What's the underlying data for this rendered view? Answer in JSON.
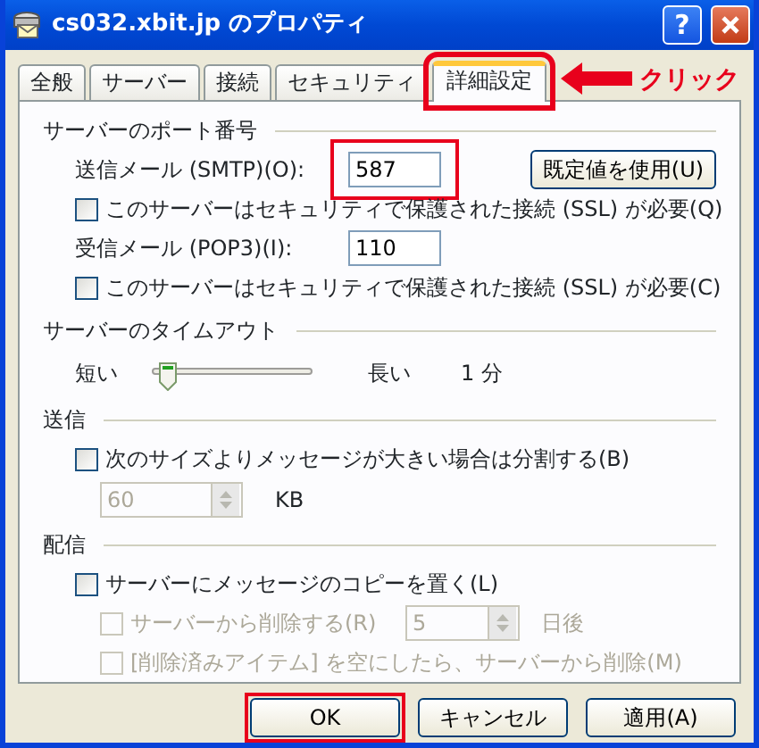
{
  "window": {
    "title": "cs032.xbit.jp のプロパティ",
    "help_label": "?"
  },
  "tabs": [
    {
      "label": "全般",
      "selected": false,
      "highlighted": false
    },
    {
      "label": "サーバー",
      "selected": false,
      "highlighted": false
    },
    {
      "label": "接続",
      "selected": false,
      "highlighted": false
    },
    {
      "label": "セキュリティ",
      "selected": false,
      "highlighted": false
    },
    {
      "label": "詳細設定",
      "selected": true,
      "highlighted": true
    }
  ],
  "annotation": {
    "text": "クリック"
  },
  "sections": [
    {
      "title": "サーバーのポート番号",
      "rows": [
        {
          "kind": "port",
          "label": "送信メール (SMTP)(O):",
          "value": "587",
          "highlighted": true,
          "button": "既定値を使用(U)"
        },
        {
          "kind": "checkbox",
          "label": "このサーバーはセキュリティで保護された接続 (SSL) が必要(Q)",
          "checked": false,
          "disabled": false
        },
        {
          "kind": "port",
          "label": "受信メール (POP3)(I):",
          "value": "110",
          "highlighted": false
        },
        {
          "kind": "checkbox",
          "label": "このサーバーはセキュリティで保護された接続 (SSL) が必要(C)",
          "checked": false,
          "disabled": false
        }
      ]
    },
    {
      "title": "サーバーのタイムアウト",
      "rows": [
        {
          "kind": "slider",
          "min_label": "短い",
          "max_label": "長い",
          "level": 0.1,
          "reading": "1 分"
        }
      ]
    },
    {
      "title": "送信",
      "rows": [
        {
          "kind": "checkbox",
          "label": "次のサイズよりメッセージが大きい場合は分割する(B)",
          "checked": false,
          "disabled": false
        },
        {
          "kind": "spinner",
          "value": "60",
          "unit": "KB",
          "disabled": true
        }
      ]
    },
    {
      "title": "配信",
      "rows": [
        {
          "kind": "checkbox",
          "label": "サーバーにメッセージのコピーを置く(L)",
          "checked": false,
          "disabled": false
        },
        {
          "kind": "checkbox_spinner",
          "label": "サーバーから削除する(R)",
          "checked": false,
          "disabled": true,
          "value": "5",
          "unit": "日後"
        },
        {
          "kind": "sub_checkbox",
          "label": "[削除済みアイテム] を空にしたら、サーバーから削除(M)",
          "checked": false,
          "disabled": true
        }
      ]
    }
  ],
  "buttons": [
    {
      "label": "OK",
      "highlighted": true
    },
    {
      "label": "キャンセル",
      "highlighted": false
    },
    {
      "label": "適用(A)",
      "highlighted": false
    }
  ]
}
